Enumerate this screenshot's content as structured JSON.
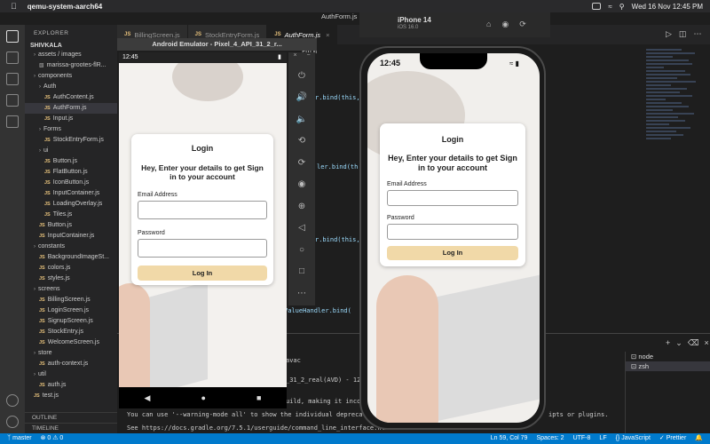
{
  "menubar": {
    "app_name": "qemu-system-aarch64",
    "datetime": "Wed 16 Nov  12:45 PM"
  },
  "vscode": {
    "window_title": "AuthForm.js",
    "explorer": {
      "title": "EXPLORER",
      "workspace": "SHIVKALA",
      "rows": [
        {
          "label": "assets / images",
          "type": "folder"
        },
        {
          "label": "marissa-grootes-flR...",
          "type": "file"
        },
        {
          "label": "components",
          "type": "folder"
        },
        {
          "label": "Auth",
          "type": "folder"
        },
        {
          "label": "AuthContent.js",
          "type": "js"
        },
        {
          "label": "AuthForm.js",
          "type": "js",
          "selected": true
        },
        {
          "label": "Input.js",
          "type": "js"
        },
        {
          "label": "Forms",
          "type": "folder"
        },
        {
          "label": "StockEntryForm.js",
          "type": "js"
        },
        {
          "label": "ui",
          "type": "folder"
        },
        {
          "label": "Button.js",
          "type": "js"
        },
        {
          "label": "FlatButton.js",
          "type": "js"
        },
        {
          "label": "IconButton.js",
          "type": "js"
        },
        {
          "label": "InputContainer.js",
          "type": "js"
        },
        {
          "label": "LoadingOverlay.js",
          "type": "js"
        },
        {
          "label": "Tiles.js",
          "type": "js"
        },
        {
          "label": "Button.js",
          "type": "js"
        },
        {
          "label": "InputContainer.js",
          "type": "js"
        },
        {
          "label": "constants",
          "type": "folder"
        },
        {
          "label": "BackgroundImageSt...",
          "type": "js"
        },
        {
          "label": "colors.js",
          "type": "js"
        },
        {
          "label": "styles.js",
          "type": "js"
        },
        {
          "label": "screens",
          "type": "folder"
        },
        {
          "label": "BillingScreen.js",
          "type": "js"
        },
        {
          "label": "LoginScreen.js",
          "type": "js"
        },
        {
          "label": "SignupScreen.js",
          "type": "js"
        },
        {
          "label": "StockEntry.js",
          "type": "js"
        },
        {
          "label": "WelcomeScreen.js",
          "type": "js"
        },
        {
          "label": "store",
          "type": "folder"
        },
        {
          "label": "auth-context.js",
          "type": "js"
        },
        {
          "label": "util",
          "type": "folder"
        },
        {
          "label": "auth.js",
          "type": "js"
        },
        {
          "label": "test.js",
          "type": "js"
        }
      ],
      "outline": "OUTLINE",
      "timeline": "TIMELINE"
    },
    "tabs": [
      {
        "label": "BillingScreen.js",
        "active": false
      },
      {
        "label": "StockEntryForm.js",
        "active": false
      },
      {
        "label": "AuthForm.js",
        "active": true
      }
    ],
    "breadcrumb_tail": "Form",
    "code_fragments": [
      "r.bind(this,",
      "ler.bind(th",
      "r.bind(this,",
      "ValueHandler.bind("
    ],
    "terminal": {
      "lines": [
        "avac",
        "_31_2_real(AVD) - 12'",
        "uild, making it incom",
        "You can use '--warning-mode all' to show the individual deprecation",
        "See https://docs.gradle.org/7.5.1/userguide/command_line_interface.htm"
      ],
      "line_right": "ipts or plugins.",
      "list": [
        "node",
        "zsh"
      ]
    },
    "statusbar": {
      "branch": "master",
      "errors": "⊗ 0 ⚠ 0",
      "cursor": "Ln 59, Col 79",
      "spaces": "Spaces: 2",
      "encoding": "UTF-8",
      "eol": "LF",
      "language": "{} JavaScript",
      "prettier": "✓ Prettier"
    }
  },
  "android": {
    "window_title": "Android Emulator - Pixel_4_API_31_2_r...",
    "time": "12:45",
    "login": {
      "title": "Login",
      "subtitle": "Hey, Enter your details to get Sign in to your account",
      "email_label": "Email Address",
      "password_label": "Password",
      "button": "Log In"
    }
  },
  "ios": {
    "device": "iPhone 14",
    "os": "iOS 16.0",
    "time": "12:45",
    "login": {
      "title": "Login",
      "subtitle": "Hey, Enter your details to get Sign in to your account",
      "email_label": "Email Address",
      "password_label": "Password",
      "button": "Log In"
    }
  }
}
